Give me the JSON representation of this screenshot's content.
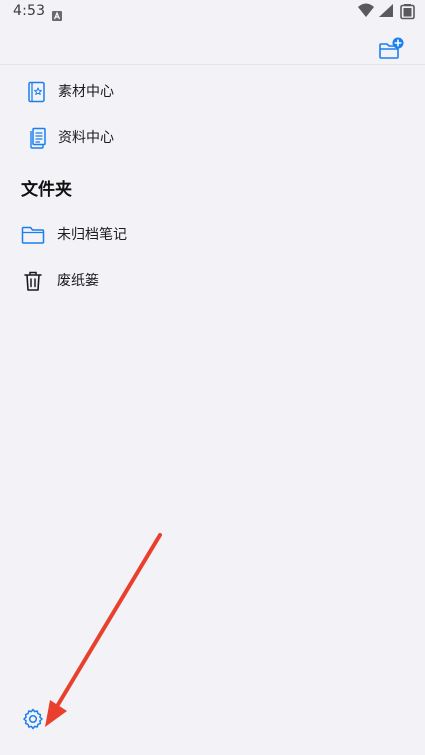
{
  "status_bar": {
    "time": "4:53",
    "icons": [
      "android-a-icon",
      "wifi-icon",
      "signal-icon",
      "battery-icon"
    ]
  },
  "top_bar": {
    "action_icon": "new-folder-icon",
    "accent_color": "#1a7ff0"
  },
  "library_items": [
    {
      "label": "素材中心",
      "icon": "star-book-icon"
    },
    {
      "label": "资料中心",
      "icon": "document-icon"
    }
  ],
  "folders": {
    "title": "文件夹",
    "items": [
      {
        "label": "未归档笔记",
        "icon": "folder-icon"
      },
      {
        "label": "废纸篓",
        "icon": "trash-icon"
      }
    ]
  },
  "footer": {
    "settings_icon": "gear-icon"
  },
  "annotation": {
    "arrow_color": "#e8402c"
  }
}
